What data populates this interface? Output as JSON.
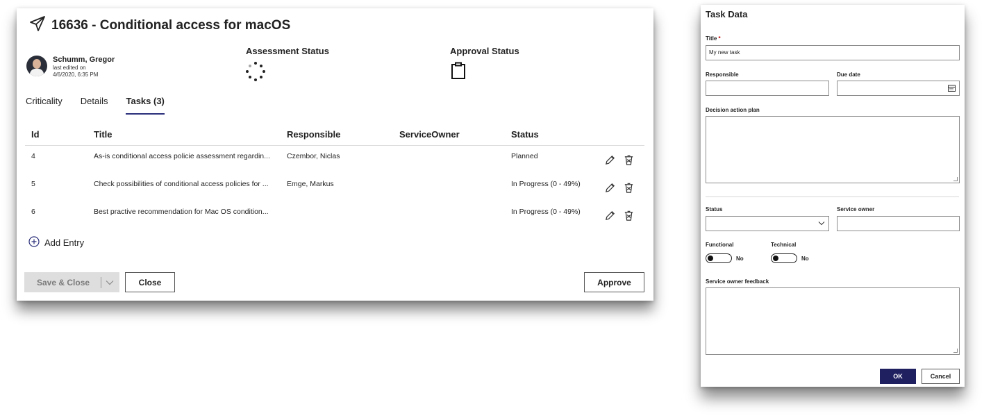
{
  "icons": {
    "title_icon": "paper-plane-icon",
    "assessment_icon": "loading-spinner-icon",
    "approval_icon": "clipboard-icon",
    "edit_icon": "pencil-icon",
    "delete_icon": "trash-icon",
    "add_icon": "plus-circle-icon",
    "calendar_icon": "calendar-icon",
    "dropdown_icon": "chevron-down-icon"
  },
  "colors": {
    "accent": "#2b2f7a",
    "primary_button": "#1f2060",
    "required": "#c00000"
  },
  "dialog": {
    "title": "16636 - Conditional access for macOS",
    "user": {
      "name": "Schumm, Gregor",
      "edited_label": "last edited on",
      "edited_at": "4/6/2020, 6:35 PM"
    },
    "assessment_status_label": "Assessment Status",
    "approval_status_label": "Approval Status",
    "tabs": [
      {
        "label": "Criticality",
        "active": false
      },
      {
        "label": "Details",
        "active": false
      },
      {
        "label": "Tasks (3)",
        "active": true
      }
    ],
    "table": {
      "columns": [
        "Id",
        "Title",
        "Responsible",
        "ServiceOwner",
        "Status"
      ],
      "rows": [
        {
          "id": "4",
          "title": "As-is conditional access policie assessment regardin...",
          "responsible": "Czembor, Niclas",
          "service_owner": "",
          "status": "Planned"
        },
        {
          "id": "5",
          "title": "Check possibilities of conditional access policies for ...",
          "responsible": "Emge, Markus",
          "service_owner": "",
          "status": "In Progress (0 - 49%)"
        },
        {
          "id": "6",
          "title": "Best practive recommendation for Mac OS condition...",
          "responsible": "",
          "service_owner": "",
          "status": "In Progress (0 - 49%)"
        }
      ]
    },
    "add_entry_label": "Add Entry",
    "buttons": {
      "save_close": "Save & Close",
      "close": "Close",
      "approve": "Approve"
    }
  },
  "task_form": {
    "header": "Task Data",
    "title_label": "Title",
    "required_mark": "*",
    "title_value": "My new task",
    "responsible_label": "Responsible",
    "responsible_value": "",
    "due_date_label": "Due date",
    "due_date_value": "",
    "decision_label": "Decision action plan",
    "status_label": "Status",
    "status_value": "",
    "service_owner_label": "Service owner",
    "service_owner_value": "",
    "functional_label": "Functional",
    "functional_value": "No",
    "technical_label": "Technical",
    "technical_value": "No",
    "feedback_label": "Service owner feedback",
    "ok_label": "OK",
    "cancel_label": "Cancel"
  }
}
